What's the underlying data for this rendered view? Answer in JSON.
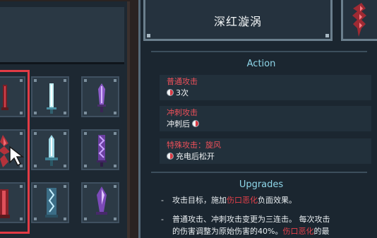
{
  "weapon": {
    "name": "深红漩涡",
    "icon": "crimson-sword-icon"
  },
  "action_section": {
    "heading": "Action",
    "attacks": [
      {
        "label": "普通攻击",
        "value": "3次",
        "icon": "mouse-click-icon",
        "icon_position": "before"
      },
      {
        "label": "冲刺攻击",
        "value": "冲刺后",
        "icon": "mouse-click-icon",
        "icon_position": "after"
      },
      {
        "label": "特殊攻击：旋风",
        "value": "充电后松开",
        "icon": "mouse-click-icon",
        "icon_position": "before"
      }
    ]
  },
  "upgrades_section": {
    "heading": "Upgrades",
    "items": [
      {
        "bullet": "-",
        "text_before": "攻击目标，施加",
        "highlight": "伤口恶化",
        "text_after": "负面效果。"
      },
      {
        "bullet": "-",
        "line1": "普通攻击、冲刺攻击变更为三连击。 每次攻击",
        "line2_before": "的伤害调整为原始伤害的40%。",
        "line2_highlight": "伤口恶化",
        "line2_after": "的最"
      }
    ]
  },
  "inventory": {
    "slots": [
      {
        "item": "crimson-blade-icon",
        "selected": true
      },
      {
        "item": "ice-sword-icon",
        "selected": false
      },
      {
        "item": "purple-dagger-icon",
        "selected": false
      },
      {
        "item": "crimson-vortex-sword-icon",
        "selected": true
      },
      {
        "item": "frost-sword-icon",
        "selected": false
      },
      {
        "item": "violet-blade-icon",
        "selected": false
      },
      {
        "item": "red-greatsword-icon",
        "selected": true
      },
      {
        "item": "lightning-sword-icon",
        "selected": false
      },
      {
        "item": "amethyst-sword-icon",
        "selected": false
      }
    ]
  },
  "colors": {
    "accent_red": "#e23b45",
    "heading_cyan": "#8fd7ea",
    "panel_bg": "#1b2630"
  }
}
